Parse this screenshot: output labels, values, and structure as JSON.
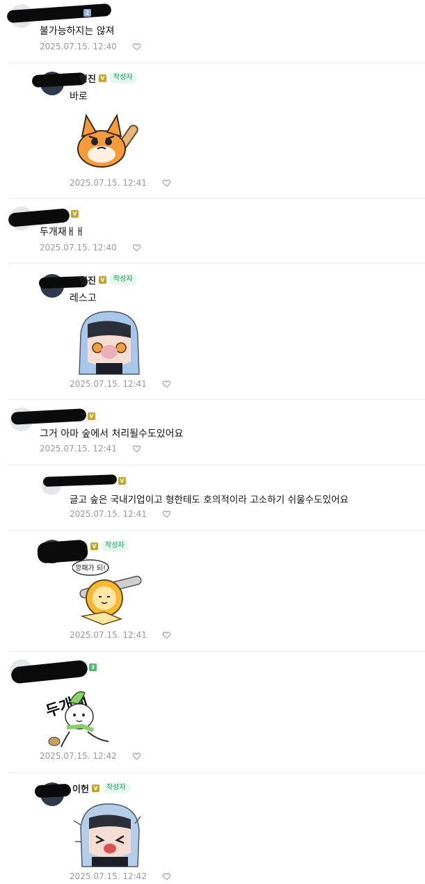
{
  "comments": [
    {
      "text": "불가능하지는 않져",
      "time": "2025.07.15. 12:40",
      "badge": "2",
      "badge_color": "#8aa8d8"
    },
    {
      "nick": "형진",
      "text": "바로",
      "time": "2025.07.15. 12:41",
      "badge": "V",
      "author_tag": "작성자",
      "sticker": "fox-with-bat-sticker"
    },
    {
      "text": "두개재ㅐㅐ",
      "time": "2025.07.15. 12:40",
      "badge": "V"
    },
    {
      "nick": "형진",
      "text": "레스고",
      "time": "2025.07.15. 12:41",
      "badge": "V",
      "author_tag": "작성자",
      "sticker": "blue-hair-girl-sticker"
    },
    {
      "text": "그거 아마 숲에서 처리될수도있어요",
      "time": "2025.07.15. 12:41",
      "badge": "V"
    },
    {
      "text": "글고 숲은 국내기업이고 형한테도 호의적이라 고소하기 쉬울수도있어요",
      "time": "2025.07.15. 12:41",
      "badge": "V"
    },
    {
      "text": "",
      "time": "2025.07.15. 12:41",
      "badge": "V",
      "author_tag": "작성자",
      "sticker": "lion-with-bat-sticker",
      "sticker_caption": "깡패가 되!"
    },
    {
      "text": "",
      "time": "2025.07.15. 12:42",
      "badge": "3",
      "badge_color": "#4cb86a",
      "sticker": "dugaejae-onion-sticker",
      "sticker_caption": "두개재"
    },
    {
      "nick": "이헌",
      "text": "",
      "time": "2025.07.15. 12:42",
      "badge": "V",
      "author_tag": "작성자",
      "sticker": "crying-girl-sticker"
    }
  ],
  "colors": {
    "author_tag": "#03a85a",
    "badge_v": "#c9a227",
    "meta": "#9a9a9a"
  }
}
